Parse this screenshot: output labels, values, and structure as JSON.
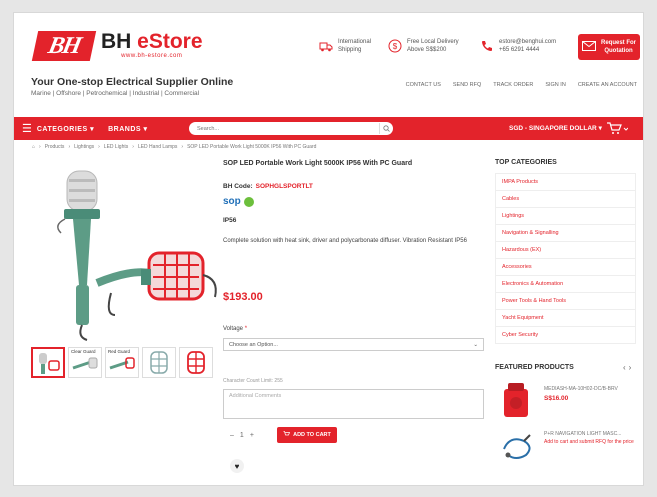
{
  "header": {
    "logo_mark": "BH",
    "logo_brand": "BH ",
    "logo_store": "eStore",
    "logo_url": "www.bh-estore.com",
    "international_line1": "International",
    "international_line2": "Shipping",
    "delivery_line1": "Free Local Delivery",
    "delivery_line2": "Above S$$200",
    "email": "estore@benghui.com",
    "phone": "+65 6291 4444",
    "rfq_line1": "Request For",
    "rfq_line2": "Quotation",
    "tagline": "Your One-stop Electrical Supplier Online",
    "sectors": "Marine | Offshore | Petrochemical | Industrial | Commercial",
    "top_links": [
      "CONTACT US",
      "SEND RFQ",
      "TRACK ORDER",
      "SIGN IN",
      "CREATE AN ACCOUNT"
    ]
  },
  "nav": {
    "categories": "CATEGORIES",
    "brands": "BRANDS",
    "search_placeholder": "Search...",
    "currency": "SGD - SINGAPORE DOLLAR"
  },
  "breadcrumb": [
    "Products",
    "Lightings",
    "LED Lights",
    "LED Hand Lamps",
    "SOP LED Portable Work Light 5000K IP56 With PC Guard"
  ],
  "product": {
    "title": "SOP LED Portable Work Light 5000K IP56 With PC Guard",
    "bh_code_label": "BH Code:",
    "bh_code": "SOPHGLSPORTLT",
    "brand": "sop",
    "rating": "IP56",
    "description": "Complete solution with heat sink, driver and polycarbonate diffuser. Vibration Resistant IP56",
    "price": "$193.00",
    "voltage_label": "Voltage",
    "voltage_required": "*",
    "voltage_option": "Choose an Option...",
    "char_limit": "Character Count Limit: 255",
    "notes_placeholder": "Additional Comments",
    "qty": "1",
    "add_to_cart": "ADD TO CART",
    "thumbs": [
      {
        "label": ""
      },
      {
        "label": "Clear Guard"
      },
      {
        "label": "Red Guard"
      },
      {
        "label": ""
      },
      {
        "label": ""
      }
    ]
  },
  "sidebar": {
    "top_categories_title": "TOP CATEGORIES",
    "categories": [
      "IMPA Products",
      "Cables",
      "Lightings",
      "Navigation & Signalling",
      "Hazardous (EX)",
      "Accessories",
      "Electronics & Automation",
      "Power Tools & Hand Tools",
      "Yacht Equipment",
      "Cyber Security"
    ],
    "featured_title": "FEATURED PRODUCTS",
    "featured": [
      {
        "name": "MEDIASH-MA-10H02-DC/B-BRV",
        "price": "S$16.00"
      },
      {
        "name": "P+R NAVIGATION LIGHT MASC...",
        "note": "Add to cart and submit RFQ for the price"
      }
    ]
  },
  "colors": {
    "brand_red": "#e3232b"
  }
}
